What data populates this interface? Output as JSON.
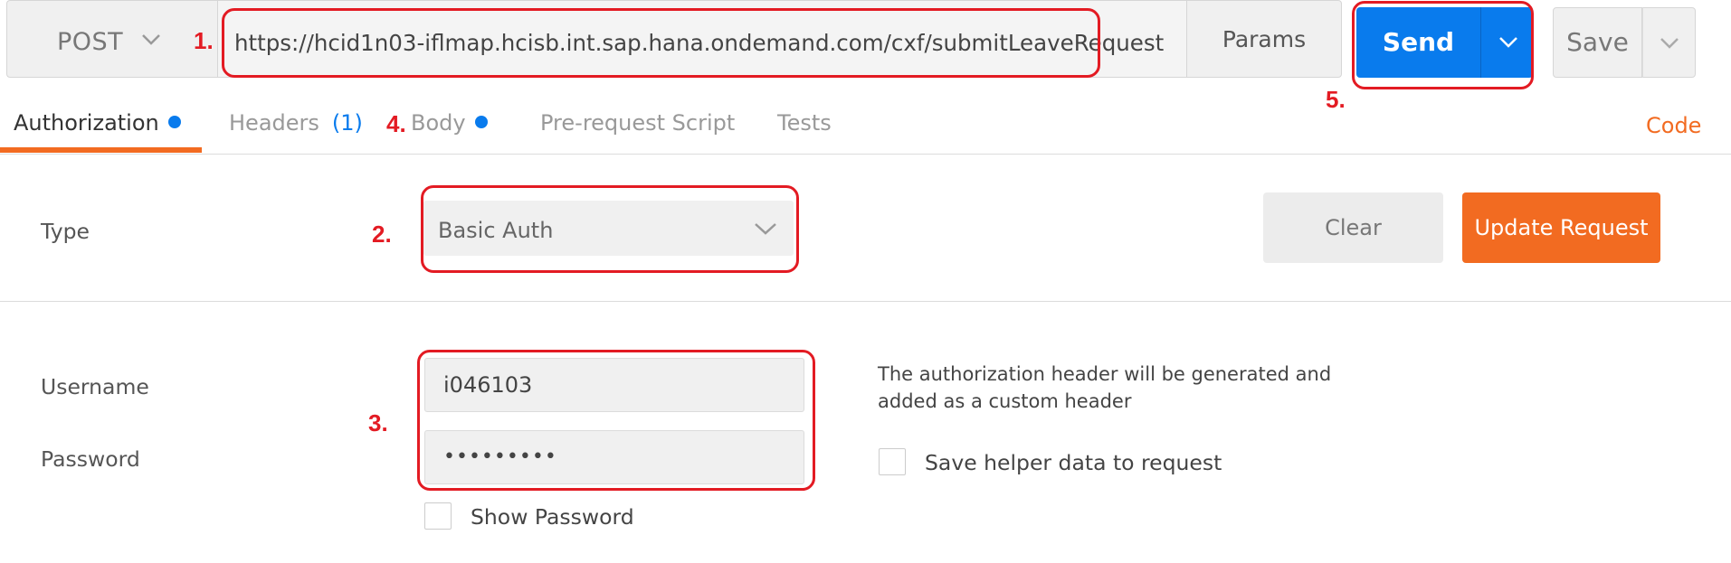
{
  "request": {
    "method": "POST",
    "url": "https://hcid1n03-iflmap.hcisb.int.sap.hana.ondemand.com/cxf/submitLeaveRequest",
    "params_label": "Params",
    "send_label": "Send",
    "save_label": "Save"
  },
  "tabs": [
    {
      "label": "Authorization",
      "active": true,
      "has_dot": true
    },
    {
      "label": "Headers",
      "count": "(1)"
    },
    {
      "label": "Body",
      "has_dot": true
    },
    {
      "label": "Pre-request Script"
    },
    {
      "label": "Tests"
    }
  ],
  "code_link": "Code",
  "auth": {
    "type_label": "Type",
    "type_value": "Basic Auth",
    "clear_label": "Clear",
    "update_label": "Update Request",
    "username_label": "Username",
    "username_value": "i046103",
    "password_label": "Password",
    "password_masked": "•••••••••",
    "show_password_label": "Show Password",
    "help_text": "The authorization header will be generated and added as a custom header",
    "save_helper_label": "Save helper data to request"
  },
  "annotations": [
    "1.",
    "2.",
    "3.",
    "4.",
    "5."
  ],
  "colors": {
    "accent_blue": "#097bed",
    "accent_orange": "#f26b21",
    "annotation_red": "#e31b23"
  }
}
